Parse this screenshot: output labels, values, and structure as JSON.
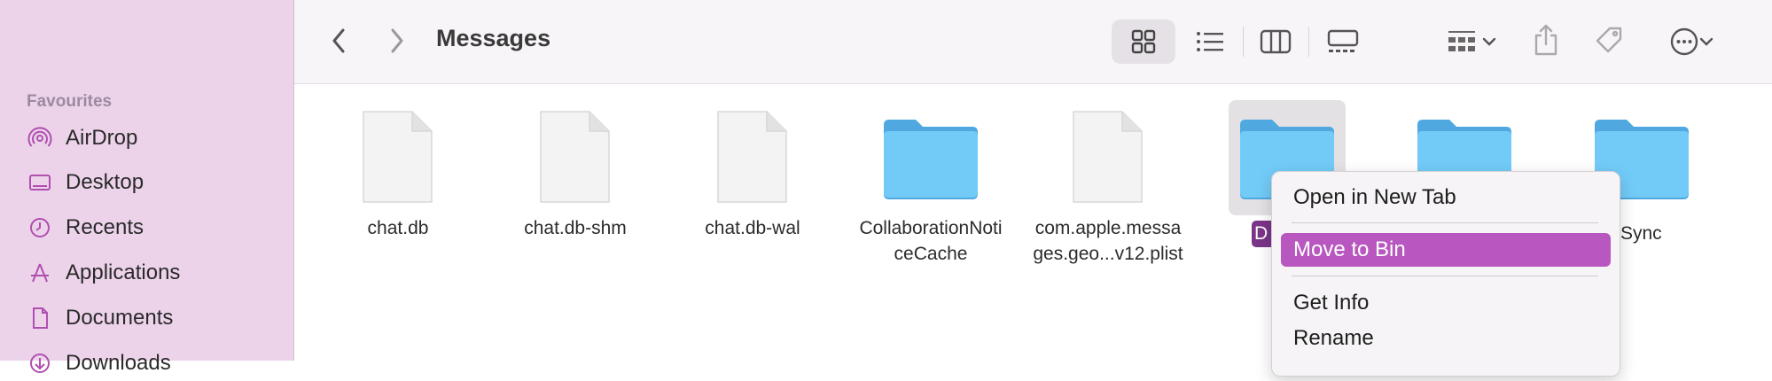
{
  "window": {
    "title": "Messages"
  },
  "sidebar": {
    "section_title": "Favourites",
    "items": [
      {
        "label": "AirDrop",
        "icon": "airdrop-icon"
      },
      {
        "label": "Desktop",
        "icon": "desktop-icon"
      },
      {
        "label": "Recents",
        "icon": "clock-icon"
      },
      {
        "label": "Applications",
        "icon": "applications-icon"
      },
      {
        "label": "Documents",
        "icon": "document-icon"
      },
      {
        "label": "Downloads",
        "icon": "download-icon"
      }
    ]
  },
  "files": [
    {
      "name": "chat.db",
      "kind": "file"
    },
    {
      "name": "chat.db-shm",
      "kind": "file"
    },
    {
      "name": "chat.db-wal",
      "kind": "file"
    },
    {
      "name": "CollaborationNoti",
      "name2": "ceCache",
      "kind": "folder"
    },
    {
      "name": "com.apple.messa",
      "name2": "ges.geo...v12.plist",
      "kind": "file"
    },
    {
      "name": "D",
      "kind": "folder",
      "selected": true
    },
    {
      "name": "",
      "kind": "folder"
    },
    {
      "name": "Sync",
      "kind": "folder"
    }
  ],
  "context_menu": {
    "items": [
      "Open in New Tab",
      "Move to Bin",
      "Get Info",
      "Rename"
    ],
    "highlighted": "Move to Bin"
  },
  "colors": {
    "sidebar_bg": "#ecd3ea",
    "accent": "#b857bf",
    "folder_blue": "#6cc6f5",
    "selection_label": "#7b3588"
  }
}
